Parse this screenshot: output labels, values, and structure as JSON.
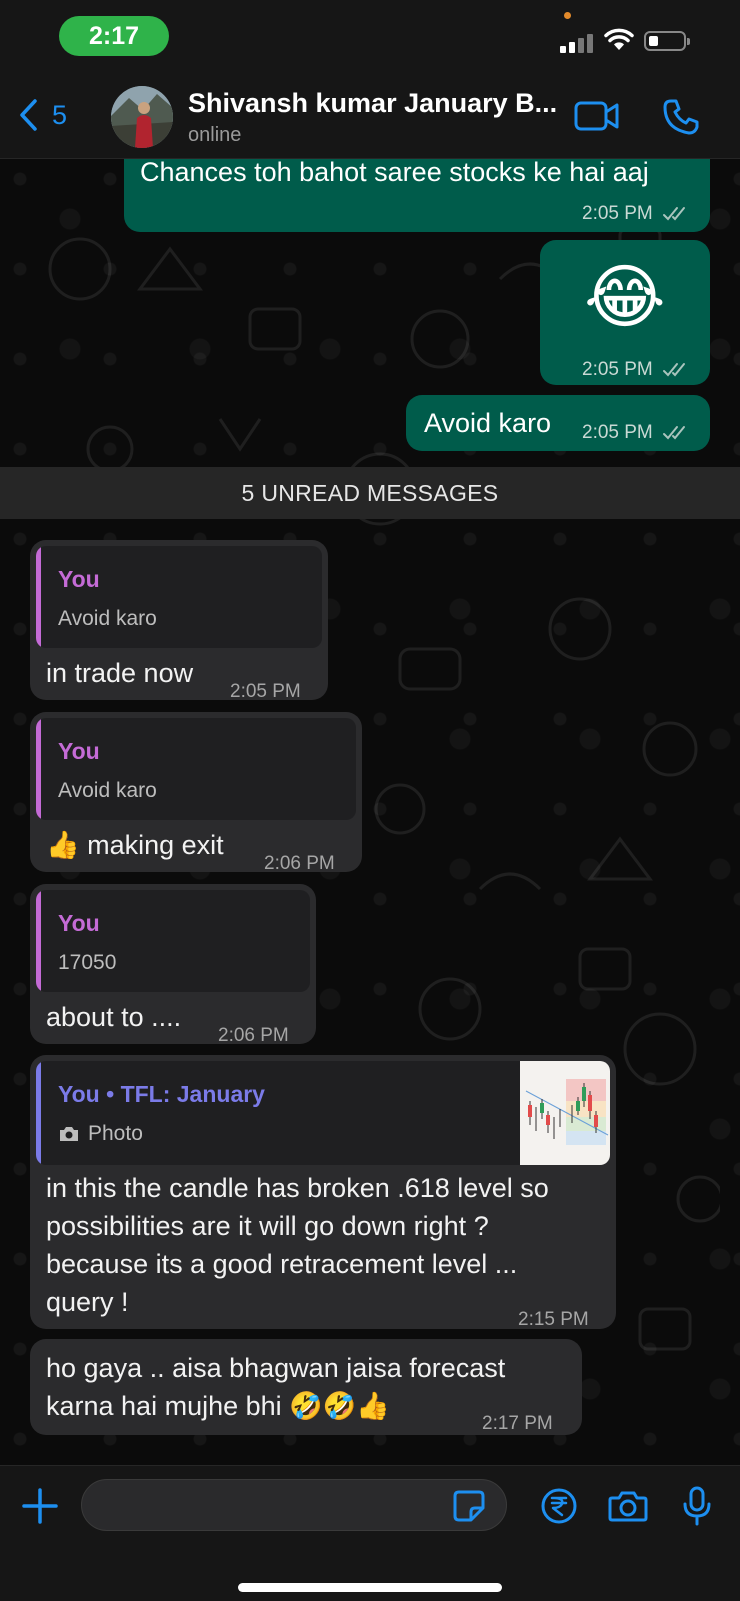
{
  "status_bar": {
    "time": "2:17"
  },
  "header": {
    "back_count": "5",
    "contact_name": "Shivansh kumar January B...",
    "contact_status": "online"
  },
  "messages_out": [
    {
      "text": "Chances toh bahot saree stocks ke hai aaj",
      "time": "2:05 PM"
    },
    {
      "text": "😂",
      "time": "2:05 PM"
    },
    {
      "text": "Avoid karo",
      "time": "2:05 PM"
    }
  ],
  "unread_banner": "5 UNREAD MESSAGES",
  "messages_in": [
    {
      "quote_author": "You",
      "quote_text": "Avoid karo",
      "text": "in trade now",
      "time": "2:05 PM"
    },
    {
      "quote_author": "You",
      "quote_text": "Avoid karo",
      "text": "👍 making exit",
      "time": "2:06 PM"
    },
    {
      "quote_author": "You",
      "quote_text": "17050",
      "text": "about to ....",
      "time": "2:06 PM"
    },
    {
      "quote_author": "You • TFL: January",
      "quote_text": "Photo",
      "lines": [
        "in this the candle has broken .618 level so",
        "possibilities are it will go down right ?",
        "because its a good retracement level ...",
        "query !"
      ],
      "time": "2:15 PM"
    },
    {
      "lines": [
        "ho gaya .. aisa bhagwan jaisa  forecast",
        "karna hai mujhe bhi 🤣🤣👍"
      ],
      "time": "2:17 PM"
    }
  ],
  "composer": {
    "placeholder": ""
  },
  "colors": {
    "accent": "#1d8ff0",
    "outgoing_bubble": "#005c4b",
    "incoming_bubble": "#2b2b2d",
    "quote_you": "#c46bd6",
    "quote_tfl": "#7b7be8"
  }
}
